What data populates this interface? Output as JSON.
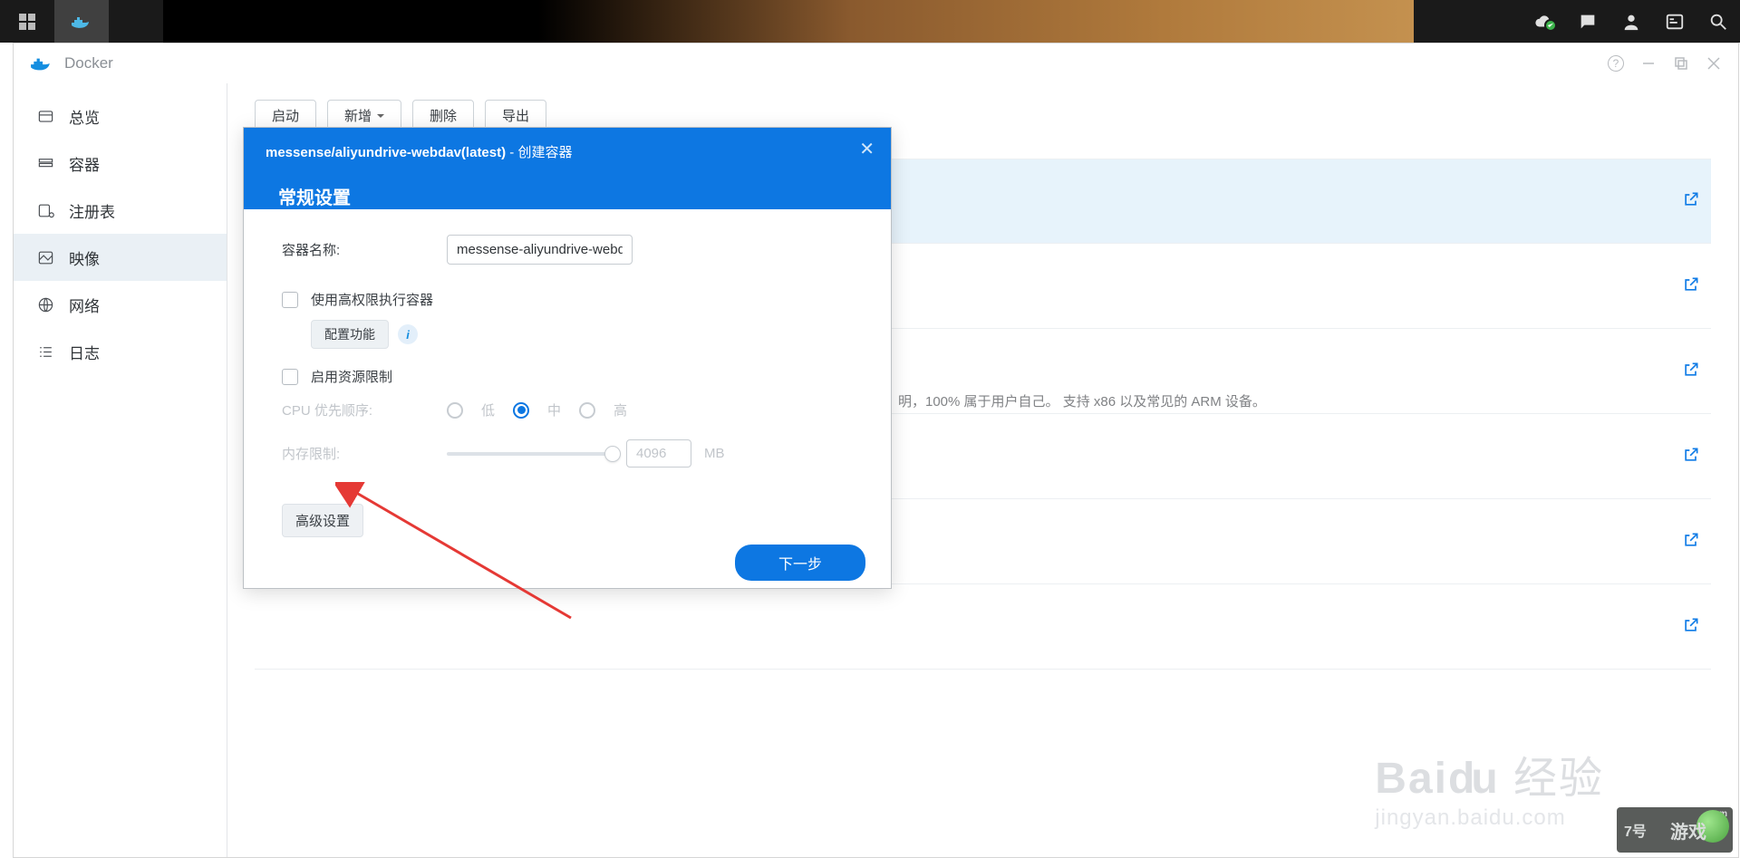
{
  "app": {
    "title": "Docker"
  },
  "sidebar": {
    "items": [
      {
        "label": "总览"
      },
      {
        "label": "容器"
      },
      {
        "label": "注册表"
      },
      {
        "label": "映像"
      },
      {
        "label": "网络"
      },
      {
        "label": "日志"
      }
    ]
  },
  "toolbar": {
    "launch_label": "启动",
    "new_label": "新增",
    "delete_label": "删除",
    "export_label": "导出"
  },
  "bg_description": "明，100% 属于用户自己。 支持 x86 以及常见的 ARM 设备。",
  "modal": {
    "breadcrumb_image": "messense/aliyundrive-webdav(latest)",
    "breadcrumb_action": "创建容器",
    "title": "常规设置",
    "container_name_label": "容器名称:",
    "container_name_value": "messense-aliyundrive-webdav",
    "priv_label": "使用高权限执行容器",
    "configure_caps": "配置功能",
    "resource_limit_label": "启用资源限制",
    "cpu_label": "CPU 优先顺序:",
    "cpu_low": "低",
    "cpu_mid": "中",
    "cpu_high": "高",
    "mem_label": "内存限制:",
    "mem_value": "4096",
    "mem_unit": "MB",
    "advanced_label": "高级设置",
    "next_label": "下一步"
  },
  "watermark": {
    "brand": "Baidu 经验",
    "url": "jingyan.baidu.com",
    "game": "游戏",
    "seven": "7号"
  }
}
